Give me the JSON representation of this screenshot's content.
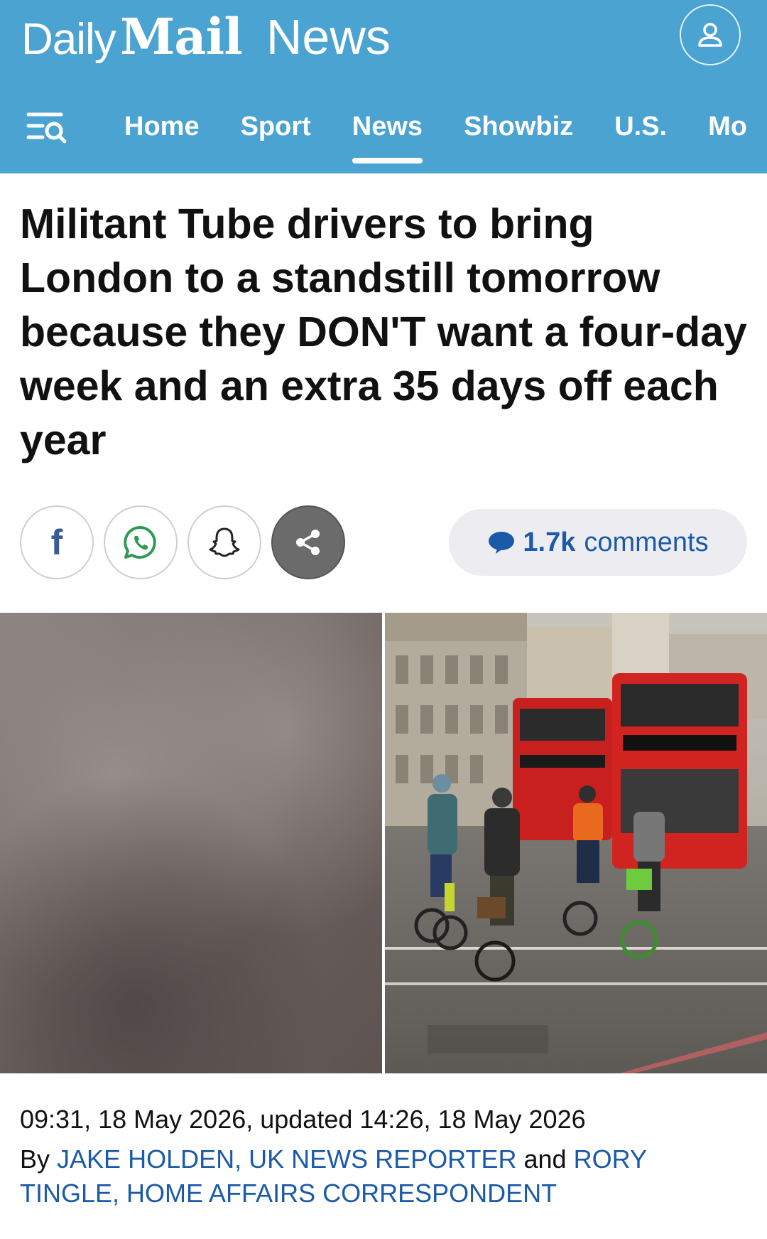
{
  "header": {
    "brand_daily": "Daily",
    "brand_mail": "Mail",
    "brand_section": "News",
    "account_icon": "user-icon",
    "menu_icon": "menu-search-icon",
    "colors": {
      "bar": "#4aa3d1",
      "text": "#ffffff"
    }
  },
  "nav": {
    "items": [
      {
        "label": "Home"
      },
      {
        "label": "Sport"
      },
      {
        "label": "News",
        "active": true
      },
      {
        "label": "Showbiz"
      },
      {
        "label": "U.S."
      },
      {
        "label": "Mo"
      }
    ]
  },
  "article": {
    "headline": "Militant Tube drivers to bring London to a standstill tomorrow because they DON'T want a four-day week and an extra 35 days off each year",
    "share": {
      "facebook_icon": "facebook-icon",
      "whatsapp_icon": "whatsapp-icon",
      "snapchat_icon": "snapchat-icon",
      "share_icon": "share-icon"
    },
    "comments": {
      "count": "1.7k",
      "word": "comments",
      "icon": "speech-bubble-icon"
    },
    "timestamp": "09:31, 18 May 2026, updated 14:26, 18 May 2026",
    "byline": {
      "by": "By",
      "author1": "JAKE HOLDEN, UK NEWS REPORTER",
      "and": "and",
      "author2": "RORY TINGLE, HOME AFFAIRS CORRESPONDENT"
    },
    "colors": {
      "link": "#1b5aa8",
      "headline": "#111111"
    }
  }
}
